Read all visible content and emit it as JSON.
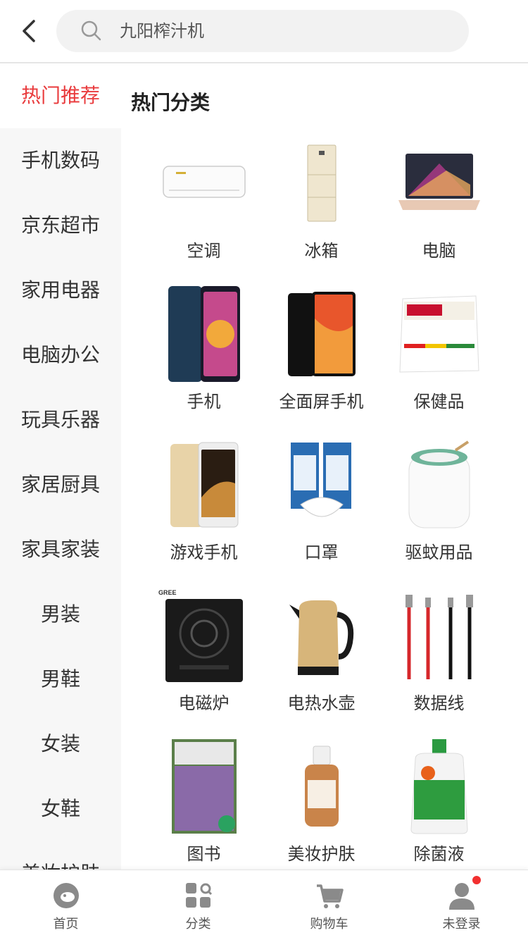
{
  "search": {
    "text": "九阳榨汁机"
  },
  "sidebar": {
    "items": [
      {
        "label": "热门推荐",
        "active": true
      },
      {
        "label": "手机数码"
      },
      {
        "label": "京东超市"
      },
      {
        "label": "家用电器"
      },
      {
        "label": "电脑办公"
      },
      {
        "label": "玩具乐器"
      },
      {
        "label": "家居厨具"
      },
      {
        "label": "家具家装"
      },
      {
        "label": "男装"
      },
      {
        "label": "男鞋"
      },
      {
        "label": "女装"
      },
      {
        "label": "女鞋"
      },
      {
        "label": "美妆护肤"
      }
    ]
  },
  "main": {
    "section_title": "热门分类",
    "categories": [
      {
        "label": "空调",
        "icon": "air-conditioner"
      },
      {
        "label": "冰箱",
        "icon": "fridge"
      },
      {
        "label": "电脑",
        "icon": "laptop"
      },
      {
        "label": "手机",
        "icon": "phone"
      },
      {
        "label": "全面屏手机",
        "icon": "fullscreen-phone"
      },
      {
        "label": "保健品",
        "icon": "vitamin-box"
      },
      {
        "label": "游戏手机",
        "icon": "gaming-phone"
      },
      {
        "label": "口罩",
        "icon": "masks"
      },
      {
        "label": "驱蚊用品",
        "icon": "mosquito-repellent"
      },
      {
        "label": "电磁炉",
        "icon": "induction-cooker"
      },
      {
        "label": "电热水壶",
        "icon": "kettle"
      },
      {
        "label": "数据线",
        "icon": "cables"
      },
      {
        "label": "图书",
        "icon": "book"
      },
      {
        "label": "美妆护肤",
        "icon": "skincare-bottle"
      },
      {
        "label": "除菌液",
        "icon": "disinfectant-bottle"
      }
    ]
  },
  "tabbar": {
    "items": [
      {
        "label": "首页",
        "icon": "home-mascot-icon"
      },
      {
        "label": "分类",
        "icon": "category-icon"
      },
      {
        "label": "购物车",
        "icon": "cart-icon"
      },
      {
        "label": "未登录",
        "icon": "user-icon"
      }
    ],
    "notification_dot_color": "#f23030"
  },
  "colors": {
    "accent": "#e93b3d"
  }
}
